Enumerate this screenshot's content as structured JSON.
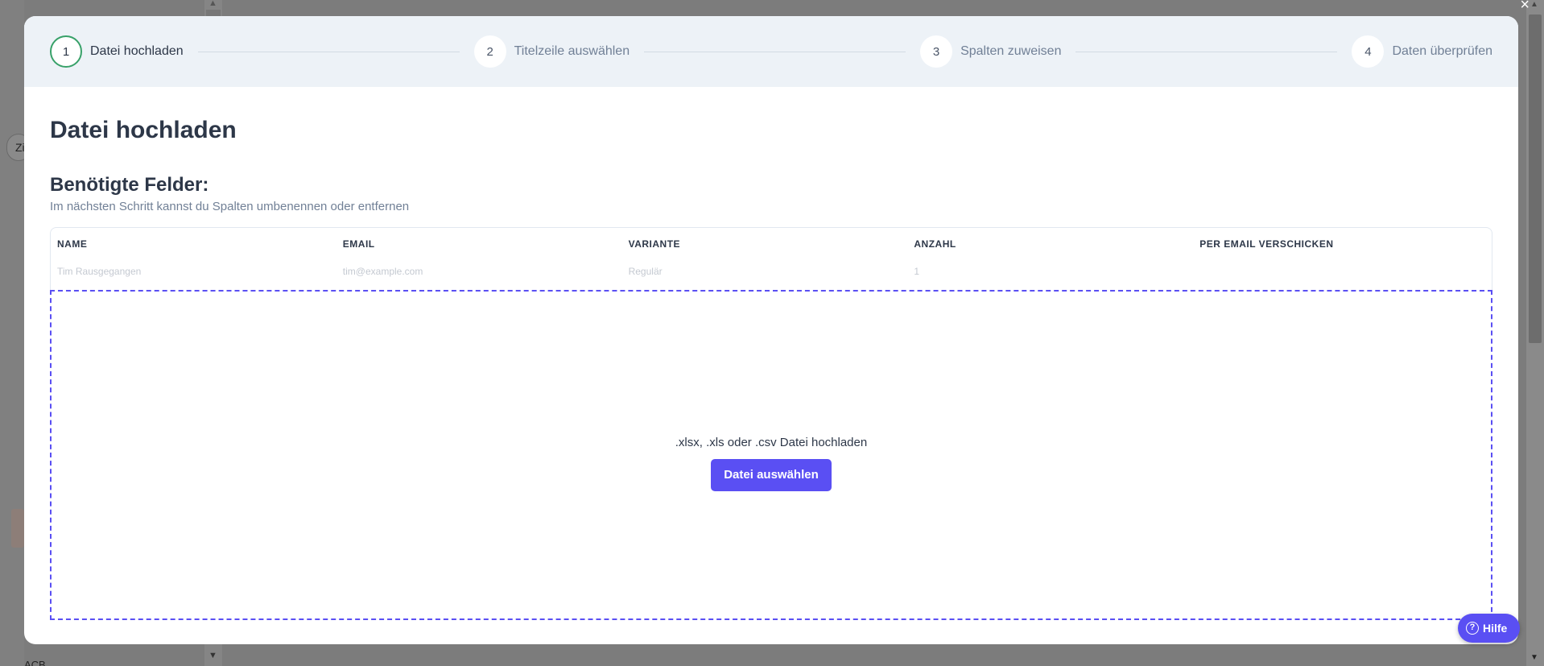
{
  "background": {
    "partial_text": "Zi",
    "bottom_text": "ACB"
  },
  "stepper": {
    "steps": [
      {
        "number": "1",
        "label": "Datei hochladen",
        "active": true
      },
      {
        "number": "2",
        "label": "Titelzeile auswählen",
        "active": false
      },
      {
        "number": "3",
        "label": "Spalten zuweisen",
        "active": false
      },
      {
        "number": "4",
        "label": "Daten überprüfen",
        "active": false
      }
    ]
  },
  "main": {
    "title": "Datei hochladen",
    "fields_heading": "Benötigte Felder:",
    "fields_subtitle": "Im nächsten Schritt kannst du Spalten umbenennen oder entfernen"
  },
  "fields_table": {
    "columns": [
      "NAME",
      "EMAIL",
      "VARIANTE",
      "ANZAHL",
      "PER EMAIL VERSCHICKEN"
    ],
    "sample_row": [
      "Tim Rausgegangen",
      "tim@example.com",
      "Regulär",
      "1",
      ""
    ]
  },
  "dropzone": {
    "text": ".xlsx, .xls oder .csv Datei hochladen",
    "button_label": "Datei auswählen"
  },
  "help": {
    "label": "Hilfe",
    "icon_glyph": "?"
  },
  "icons": {
    "close": "×",
    "arrow_up": "▲",
    "arrow_down": "▼"
  },
  "colors": {
    "accent": "#5a4ff3",
    "active_step_border": "#38a169",
    "stepper_bg": "#edf2f7",
    "title_text": "#2d3748",
    "muted_text": "#718096"
  }
}
